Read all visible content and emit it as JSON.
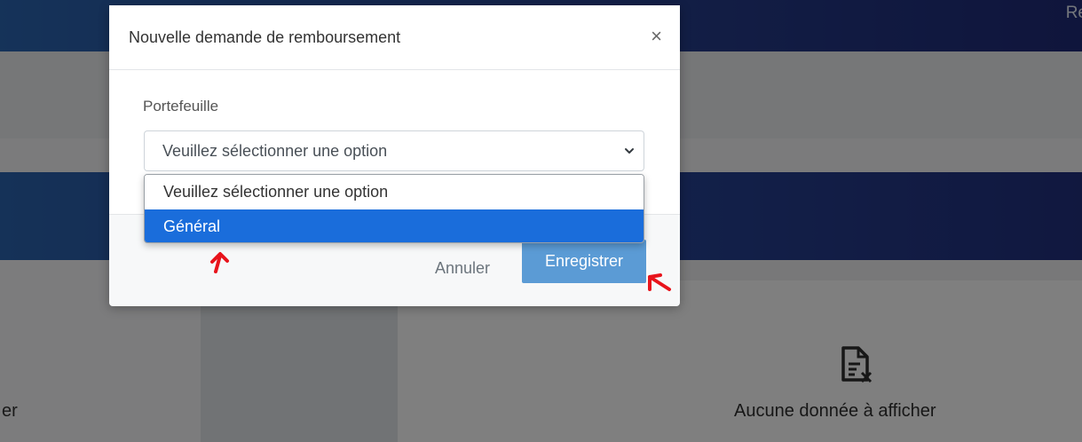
{
  "background": {
    "topbar_text": "Re",
    "left_fragment": "er",
    "no_data_icon": "file-x-icon",
    "no_data_text": "Aucune donnée à afficher"
  },
  "modal": {
    "title": "Nouvelle demande de remboursement",
    "close_symbol": "×",
    "field": {
      "label": "Portefeuille",
      "selected_value": "Veuillez sélectionner une option",
      "options": [
        "Veuillez sélectionner une option",
        "Général"
      ],
      "highlighted_option": "Général"
    },
    "footer": {
      "cancel_label": "Annuler",
      "save_label": "Enregistrer"
    }
  },
  "colors": {
    "primary_blue": "#1a6ddb",
    "save_button": "#5b9bd5",
    "annotation_red": "#e8141c"
  }
}
